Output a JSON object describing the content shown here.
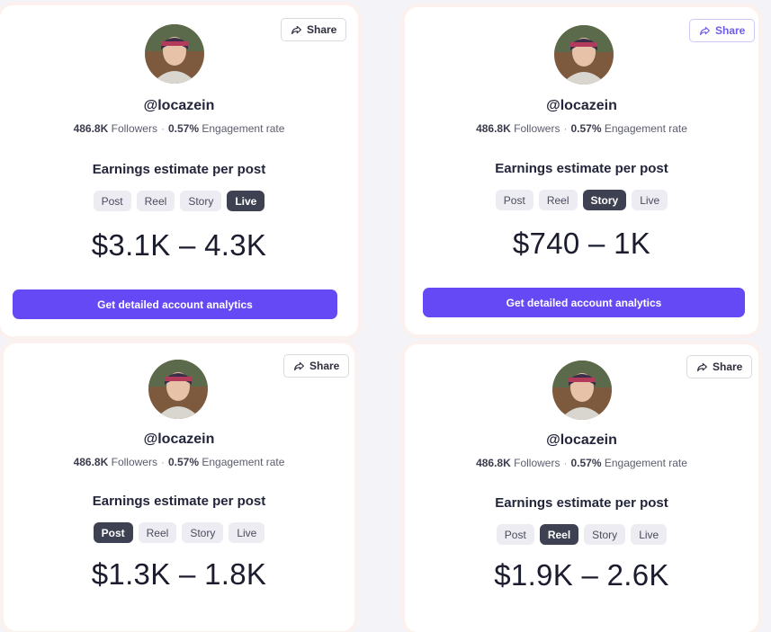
{
  "cards": [
    {
      "handle": "@locazein",
      "followers_value": "486.8K",
      "followers_label": "Followers",
      "separator": "·",
      "engagement_value": "0.57%",
      "engagement_label": "Engagement rate",
      "share_label": "Share",
      "earnings_heading": "Earnings estimate per post",
      "tabs": [
        "Post",
        "Reel",
        "Story",
        "Live"
      ],
      "active_tab": "Live",
      "price": "$3.1K – 4.3K",
      "cta_label": "Get detailed account analytics"
    },
    {
      "handle": "@locazein",
      "followers_value": "486.8K",
      "followers_label": "Followers",
      "separator": "·",
      "engagement_value": "0.57%",
      "engagement_label": "Engagement rate",
      "share_label": "Share",
      "earnings_heading": "Earnings estimate per post",
      "tabs": [
        "Post",
        "Reel",
        "Story",
        "Live"
      ],
      "active_tab": "Story",
      "price": "$740 – 1K",
      "cta_label": "Get detailed account analytics"
    },
    {
      "handle": "@locazein",
      "followers_value": "486.8K",
      "followers_label": "Followers",
      "separator": "·",
      "engagement_value": "0.57%",
      "engagement_label": "Engagement rate",
      "share_label": "Share",
      "earnings_heading": "Earnings estimate per post",
      "tabs": [
        "Post",
        "Reel",
        "Story",
        "Live"
      ],
      "active_tab": "Post",
      "price": "$1.3K – 1.8K"
    },
    {
      "handle": "@locazein",
      "followers_value": "486.8K",
      "followers_label": "Followers",
      "separator": "·",
      "engagement_value": "0.57%",
      "engagement_label": "Engagement rate",
      "share_label": "Share",
      "earnings_heading": "Earnings estimate per post",
      "tabs": [
        "Post",
        "Reel",
        "Story",
        "Live"
      ],
      "active_tab": "Reel",
      "price": "$1.9K – 2.6K"
    }
  ],
  "colors": {
    "accent": "#6549f5",
    "active_tab": "#3d4152",
    "tab_bg": "#ececf2"
  },
  "icons": {
    "share": "share-arrow-icon",
    "avatar": "profile-photo"
  }
}
